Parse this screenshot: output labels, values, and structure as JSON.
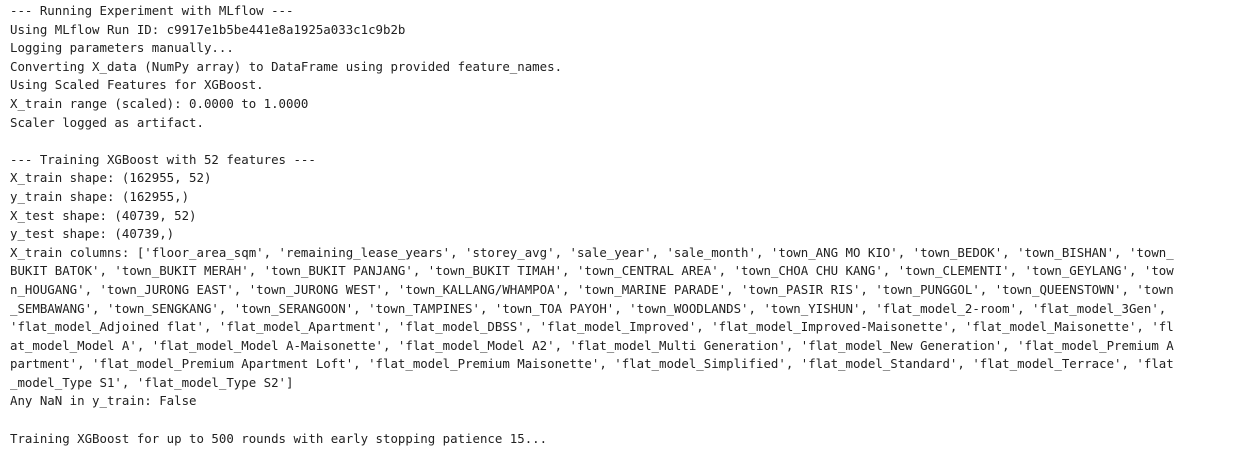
{
  "output": {
    "lines": [
      "--- Running Experiment with MLflow ---",
      "Using MLflow Run ID: c9917e1b5be441e8a1925a033c1c9b2b",
      "Logging parameters manually...",
      "Converting X_data (NumPy array) to DataFrame using provided feature_names.",
      "Using Scaled Features for XGBoost.",
      "X_train range (scaled): 0.0000 to 1.0000",
      "Scaler logged as artifact.",
      "",
      "--- Training XGBoost with 52 features ---",
      "X_train shape: (162955, 52)",
      "y_train shape: (162955,)",
      "X_test shape: (40739, 52)",
      "y_test shape: (40739,)",
      "X_train columns: ['floor_area_sqm', 'remaining_lease_years', 'storey_avg', 'sale_year', 'sale_month', 'town_ANG MO KIO', 'town_BEDOK', 'town_BISHAN', 'town_",
      "BUKIT BATOK', 'town_BUKIT MERAH', 'town_BUKIT PANJANG', 'town_BUKIT TIMAH', 'town_CENTRAL AREA', 'town_CHOA CHU KANG', 'town_CLEMENTI', 'town_GEYLANG', 'tow",
      "n_HOUGANG', 'town_JURONG EAST', 'town_JURONG WEST', 'town_KALLANG/WHAMPOA', 'town_MARINE PARADE', 'town_PASIR RIS', 'town_PUNGGOL', 'town_QUEENSTOWN', 'town",
      "_SEMBAWANG', 'town_SENGKANG', 'town_SERANGOON', 'town_TAMPINES', 'town_TOA PAYOH', 'town_WOODLANDS', 'town_YISHUN', 'flat_model_2-room', 'flat_model_3Gen',",
      "'flat_model_Adjoined flat', 'flat_model_Apartment', 'flat_model_DBSS', 'flat_model_Improved', 'flat_model_Improved-Maisonette', 'flat_model_Maisonette', 'fl",
      "at_model_Model A', 'flat_model_Model A-Maisonette', 'flat_model_Model A2', 'flat_model_Multi Generation', 'flat_model_New Generation', 'flat_model_Premium A",
      "partment', 'flat_model_Premium Apartment Loft', 'flat_model_Premium Maisonette', 'flat_model_Simplified', 'flat_model_Standard', 'flat_model_Terrace', 'flat",
      "_model_Type S1', 'flat_model_Type S2']",
      "Any NaN in y_train: False",
      "",
      "Training XGBoost for up to 500 rounds with early stopping patience 15..."
    ]
  }
}
